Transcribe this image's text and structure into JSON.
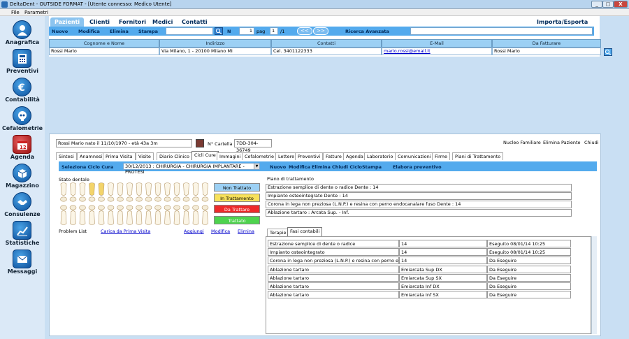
{
  "window": {
    "title": "DeltaDent - OUTSIDE FORMAT - [Utente connesso: Medico Utente]",
    "minimize": "_",
    "maximize": "□",
    "close": "X"
  },
  "menu": [
    "File",
    "Parametri"
  ],
  "nav": [
    {
      "label": "Anagrafica",
      "icon": "person-icon"
    },
    {
      "label": "Preventivi",
      "icon": "calculator-icon"
    },
    {
      "label": "Contabilità",
      "icon": "euro-icon"
    },
    {
      "label": "Cefalometrie",
      "icon": "skull-icon"
    },
    {
      "label": "Agenda",
      "icon": "calendar-icon"
    },
    {
      "label": "Magazzino",
      "icon": "box-icon"
    },
    {
      "label": "Consulenze",
      "icon": "handshake-icon"
    },
    {
      "label": "Statistiche",
      "icon": "chart-icon"
    },
    {
      "label": "Messaggi",
      "icon": "envelope-icon"
    }
  ],
  "calendar_day": "12",
  "tabs": [
    "Pazienti",
    "Clienti",
    "Fornitori",
    "Medici",
    "Contatti"
  ],
  "import_export": "Importa/Esporta",
  "toolbar": {
    "nuovo": "Nuovo",
    "modifica": "Modifica",
    "elimina": "Elimina",
    "stampa": "Stampa",
    "search_value": "",
    "n_label": "N",
    "page": "1",
    "pag_label": "pag",
    "page_of": "1",
    "total": "/1",
    "prev": "<<",
    "next": ">>",
    "advanced": "Ricerca Avanzata",
    "advanced_value": ""
  },
  "table": {
    "headers": [
      "Cognome e Nome",
      "Indirizzo",
      "Contatti",
      "E-Mail",
      "Da Fatturare"
    ],
    "row": [
      "Rossi Mario",
      "Via Milano, 1 - 20100 Milano MI",
      "Cel. 3401122333",
      "mario.rossi@email.it",
      "Rossi Mario"
    ]
  },
  "patient": {
    "info": "Rossi Mario nato il 11/10/1970 - età 43a 3m",
    "cartella_label": "N° Cartella",
    "cartella": "7DD-304-36749",
    "nucleo": "Nucleo Familiare",
    "elimina": "Elimina Paziente",
    "chiudi": "Chiudi"
  },
  "subtabs": [
    "Sintesi",
    "Anamnesi",
    "Prima Visita",
    "Visite",
    "Diario Clinico",
    "Cicli Cure",
    "Immagini",
    "Cefalometrie",
    "Lettere",
    "Preventivi",
    "Fatture",
    "Agenda",
    "Laboratorio",
    "Comunicazioni",
    "Firme",
    "Piani di Trattamento"
  ],
  "ciclo": {
    "label": "Seleziona Ciclo Cura",
    "value": "30/12/2013 : CHIRURGIA - CHIRURGIA IMPLANTARE - PROTESI",
    "nuovo": "Nuovo",
    "modifica": "Modifica",
    "elimina": "Elimina",
    "chiudi": "Chiudi Ciclo",
    "stampa": "Stampa",
    "elabora": "Elabora preventivo"
  },
  "stato_dentale": "Stato dentale",
  "legend": [
    {
      "label": "Non Trattato",
      "color": "#9cd0f4",
      "text": "#000"
    },
    {
      "label": "In Trattamento",
      "color": "#f7e15a",
      "text": "#000"
    },
    {
      "label": "Da Trattare",
      "color": "#ee2a2a",
      "text": "#fff"
    },
    {
      "label": "Trattato",
      "color": "#4ed34e",
      "text": "#fff"
    }
  ],
  "problem": {
    "label": "Problem List",
    "carica": "Carica da Prima Visita",
    "aggiungi": "Aggiungi",
    "modifica": "Modifica",
    "elimina": "Elimina"
  },
  "piano": {
    "title": "Piano di trattamento",
    "items": [
      "Estrazione semplice di dente o radice  Dente : 14",
      "Impianto osteointegrato  Dente : 14",
      "Corona in lega non preziosa (L.N.P.) e resina con perno endocanalare fuso  Dente : 14",
      "Ablazione tartaro : Arcata Sup. - Inf."
    ]
  },
  "fasi_tabs": [
    "Terapie",
    "Fasi contabili"
  ],
  "fasi": [
    [
      "Estrazione semplice di dente o radice",
      "14",
      "Eseguito 08/01/14 10:25"
    ],
    [
      "Impianto osteointegrato",
      "14",
      "Eseguito 08/01/14 10:25"
    ],
    [
      "Corona in lega non preziosa (L.N.P.) e resina con perno endo",
      "14",
      "Da Eseguire"
    ],
    [
      "Ablazione tartaro",
      "Emiarcata Sup DX",
      "Da Eseguire"
    ],
    [
      "Ablazione tartaro",
      "Emiarcata Sup SX",
      "Da Eseguire"
    ],
    [
      "Ablazione tartaro",
      "Emiarcata Inf DX",
      "Da Eseguire"
    ],
    [
      "Ablazione tartaro",
      "Emiarcata Inf SX",
      "Da Eseguire"
    ]
  ]
}
